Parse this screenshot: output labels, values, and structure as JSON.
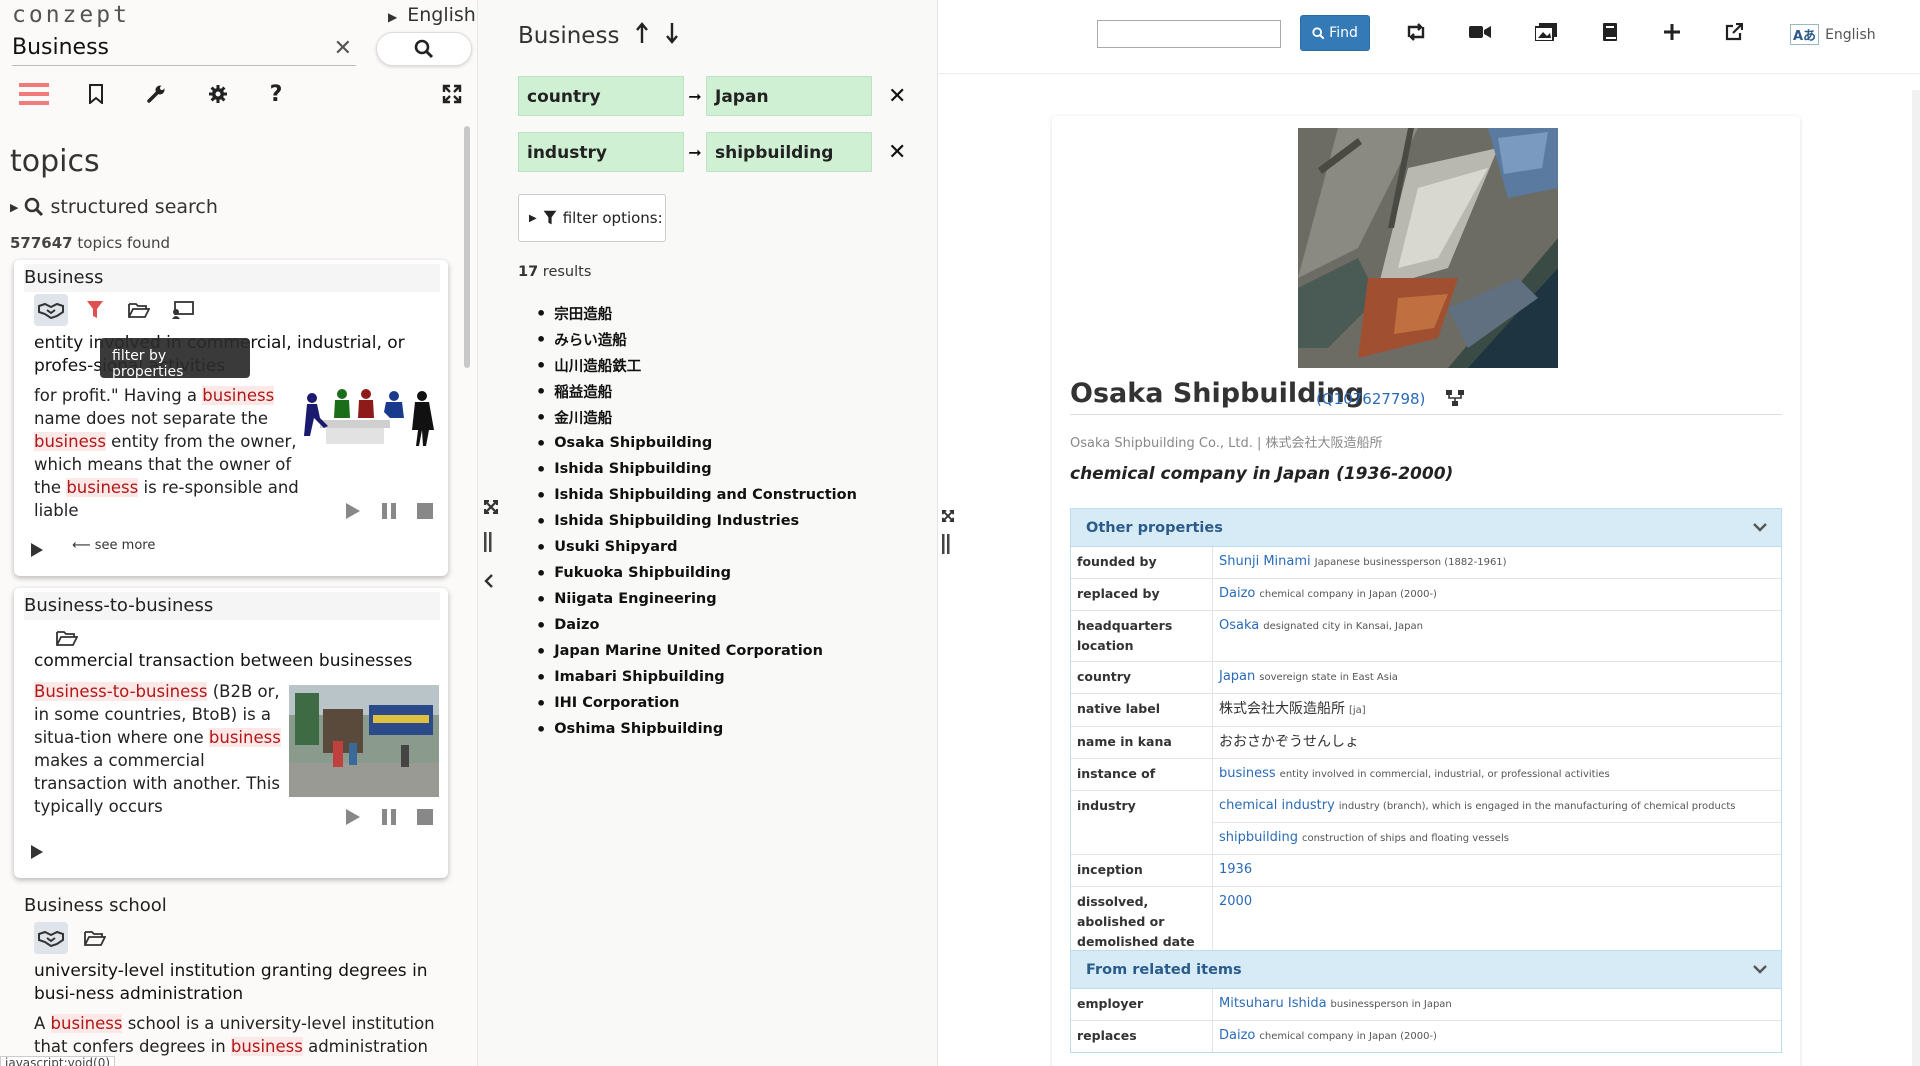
{
  "app": {
    "logo": "conzept",
    "language": "English",
    "search_value": "Business"
  },
  "left": {
    "heading": "topics",
    "structured_search": "structured search",
    "found_count": "577647",
    "found_label": "topics found",
    "tooltip": "filter by properties",
    "see_more": "see more",
    "status_bar": "javascript:void(0)",
    "cards": [
      {
        "title": "Business",
        "desc": "entity involved in commercial, industrial, or profes-sional activities",
        "extract_parts": [
          "for profit.\" Having a ",
          "business",
          " name does not separate the ",
          "business",
          " entity from the owner, which means that the owner of the ",
          "business",
          " is re-sponsible and liable"
        ]
      },
      {
        "title": "Business-to-business",
        "desc": "commercial transaction between businesses",
        "extract_parts": [
          "Business-to-business",
          " (B2B or, in some countries, BtoB) is a situa-tion where one ",
          "business",
          " makes a commercial transaction with another. This typically occurs"
        ]
      },
      {
        "title": "Business school",
        "desc": "university-level institution granting degrees in busi-ness administration",
        "extract_parts": [
          "A ",
          "business",
          " school is a university-level institution that confers degrees in ",
          "business",
          " administration or man-"
        ]
      }
    ]
  },
  "middle": {
    "title": "Business",
    "filters": [
      {
        "property": "country",
        "value": "Japan"
      },
      {
        "property": "industry",
        "value": "shipbuilding"
      }
    ],
    "filter_options": "filter options:",
    "result_count": "17",
    "result_label": "results",
    "results": [
      "宗田造船",
      "みらい造船",
      "山川造船鉄工",
      "稲益造船",
      "金川造船",
      "Osaka Shipbuilding",
      "Ishida Shipbuilding",
      "Ishida Shipbuilding and Construction",
      "Ishida Shipbuilding Industries",
      "Usuki Shipyard",
      "Fukuoka Shipbuilding",
      "Niigata Engineering",
      "Daizo",
      "Japan Marine United Corporation",
      "Imabari Shipbuilding",
      "IHI Corporation",
      "Oshima Shipbuilding"
    ]
  },
  "right": {
    "find_label": "Find",
    "language": "English",
    "article": {
      "title": "Osaka Shipbuilding",
      "qid": "(Q107627798)",
      "aliases": "Osaka Shipbuilding Co., Ltd. | 株式会社大阪造船所",
      "summary": "chemical company in Japan (1936-2000)",
      "other_properties": {
        "heading": "Other properties",
        "rows": [
          {
            "key": "founded by",
            "values": [
              {
                "link": "Shunji Minami",
                "desc": "Japanese businessperson (1882-1961)"
              }
            ]
          },
          {
            "key": "replaced by",
            "values": [
              {
                "link": "Daizo",
                "desc": "chemical company in Japan (2000-)"
              }
            ]
          },
          {
            "key": "headquarters location",
            "values": [
              {
                "link": "Osaka",
                "desc": "designated city in Kansai, Japan"
              }
            ]
          },
          {
            "key": "country",
            "values": [
              {
                "link": "Japan",
                "desc": "sovereign state in East Asia"
              }
            ]
          },
          {
            "key": "native label",
            "values": [
              {
                "plain": "株式会社大阪造船所",
                "desc": "[ja]"
              }
            ]
          },
          {
            "key": "name in kana",
            "values": [
              {
                "plain": "おおさかぞうせんしょ"
              }
            ]
          },
          {
            "key": "instance of",
            "values": [
              {
                "link": "business",
                "desc": "entity involved in commercial, industrial, or professional activities"
              }
            ]
          },
          {
            "key": "industry",
            "values": [
              {
                "link": "chemical industry",
                "desc": "industry (branch), which is engaged in the manufacturing of chemical products"
              },
              {
                "link": "shipbuilding",
                "desc": "construction of ships and floating vessels"
              }
            ]
          },
          {
            "key": "inception",
            "values": [
              {
                "link": "1936"
              }
            ]
          },
          {
            "key": "dissolved, abolished or demolished date",
            "values": [
              {
                "link": "2000"
              }
            ]
          }
        ]
      },
      "related": {
        "heading": "From related items",
        "rows": [
          {
            "key": "employer",
            "values": [
              {
                "link": "Mitsuharu Ishida",
                "desc": "businessperson in Japan"
              }
            ]
          },
          {
            "key": "replaces",
            "values": [
              {
                "link": "Daizo",
                "desc": "chemical company in Japan (2000-)"
              }
            ]
          }
        ]
      }
    }
  },
  "colors": {
    "accent_blue": "#337ab7",
    "filter_chip": "#d0f0d4",
    "highlight_bg": "#fde8e8",
    "highlight_fg": "#b01818",
    "props_header": "#d7ebf7",
    "filter_icon": "#e05050",
    "menu_icon": "#f07b7b"
  }
}
